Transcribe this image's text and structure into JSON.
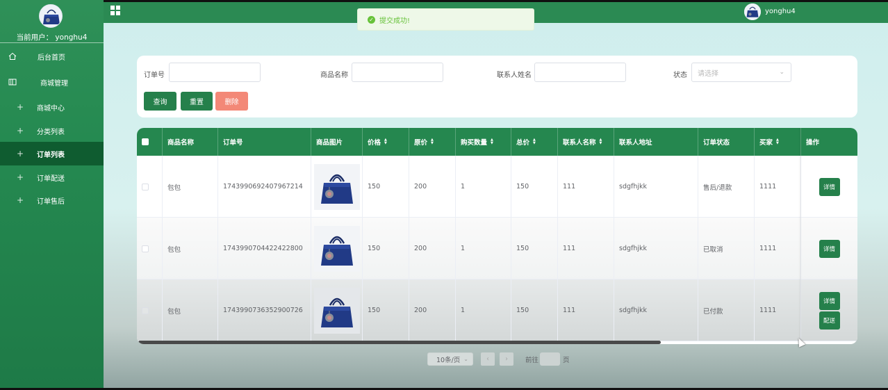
{
  "header": {
    "system_title": "",
    "username": "yonghu4"
  },
  "toast": {
    "message": "提交成功!"
  },
  "sidebar": {
    "current_user": "当前用户： yonghu4",
    "items": [
      {
        "label": "后台首页",
        "icon": "home-icon"
      },
      {
        "label": "商城管理",
        "icon": "book-icon"
      },
      {
        "label": "商城中心",
        "icon": "plus-icon"
      },
      {
        "label": "分类列表",
        "icon": "plus-icon"
      },
      {
        "label": "订单列表",
        "icon": "plus-icon",
        "active": true
      },
      {
        "label": "订单配送",
        "icon": "plus-icon"
      },
      {
        "label": "订单售后",
        "icon": "plus-icon"
      }
    ]
  },
  "search": {
    "order_no_label": "订单号",
    "order_no_value": "",
    "product_name_label": "商品名称",
    "product_name_value": "",
    "contact_name_label": "联系人姓名",
    "contact_name_value": "",
    "status_label": "状态",
    "status_placeholder": "请选择",
    "query_button": "查询",
    "reset_button": "重置",
    "delete_button": "删除"
  },
  "table": {
    "columns": [
      "商品名称",
      "订单号",
      "商品图片",
      "价格",
      "原价",
      "购买数量",
      "总价",
      "联系人名称",
      "联系人地址",
      "订单状态",
      "买家",
      "操作"
    ],
    "rows": [
      {
        "name": "包包",
        "order_no": "1743990692407967214",
        "price": "150",
        "original_price": "200",
        "qty": "1",
        "total": "150",
        "contact": "111",
        "address": "sdgfhjkk",
        "status": "售后/退款",
        "buyer": "1111",
        "actions": [
          "详情"
        ]
      },
      {
        "name": "包包",
        "order_no": "1743990704422422800",
        "price": "150",
        "original_price": "200",
        "qty": "1",
        "total": "150",
        "contact": "111",
        "address": "sdgfhjkk",
        "status": "已取消",
        "buyer": "1111",
        "actions": [
          "详情"
        ]
      },
      {
        "name": "包包",
        "order_no": "1743990736352900726",
        "price": "150",
        "original_price": "200",
        "qty": "1",
        "total": "150",
        "contact": "111",
        "address": "sdgfhjkk",
        "status": "已付款",
        "buyer": "1111",
        "actions": [
          "详情",
          "配送"
        ]
      }
    ]
  },
  "pagination": {
    "page_size": "10条/页",
    "jump_prefix": "前往",
    "jump_value": "",
    "jump_suffix": "页"
  },
  "colors": {
    "primary_green": "#25804b",
    "header_green": "#2b8a53",
    "active_menu": "#0f5c30",
    "delete_red": "#f38877",
    "toast_green": "#67c23a"
  }
}
